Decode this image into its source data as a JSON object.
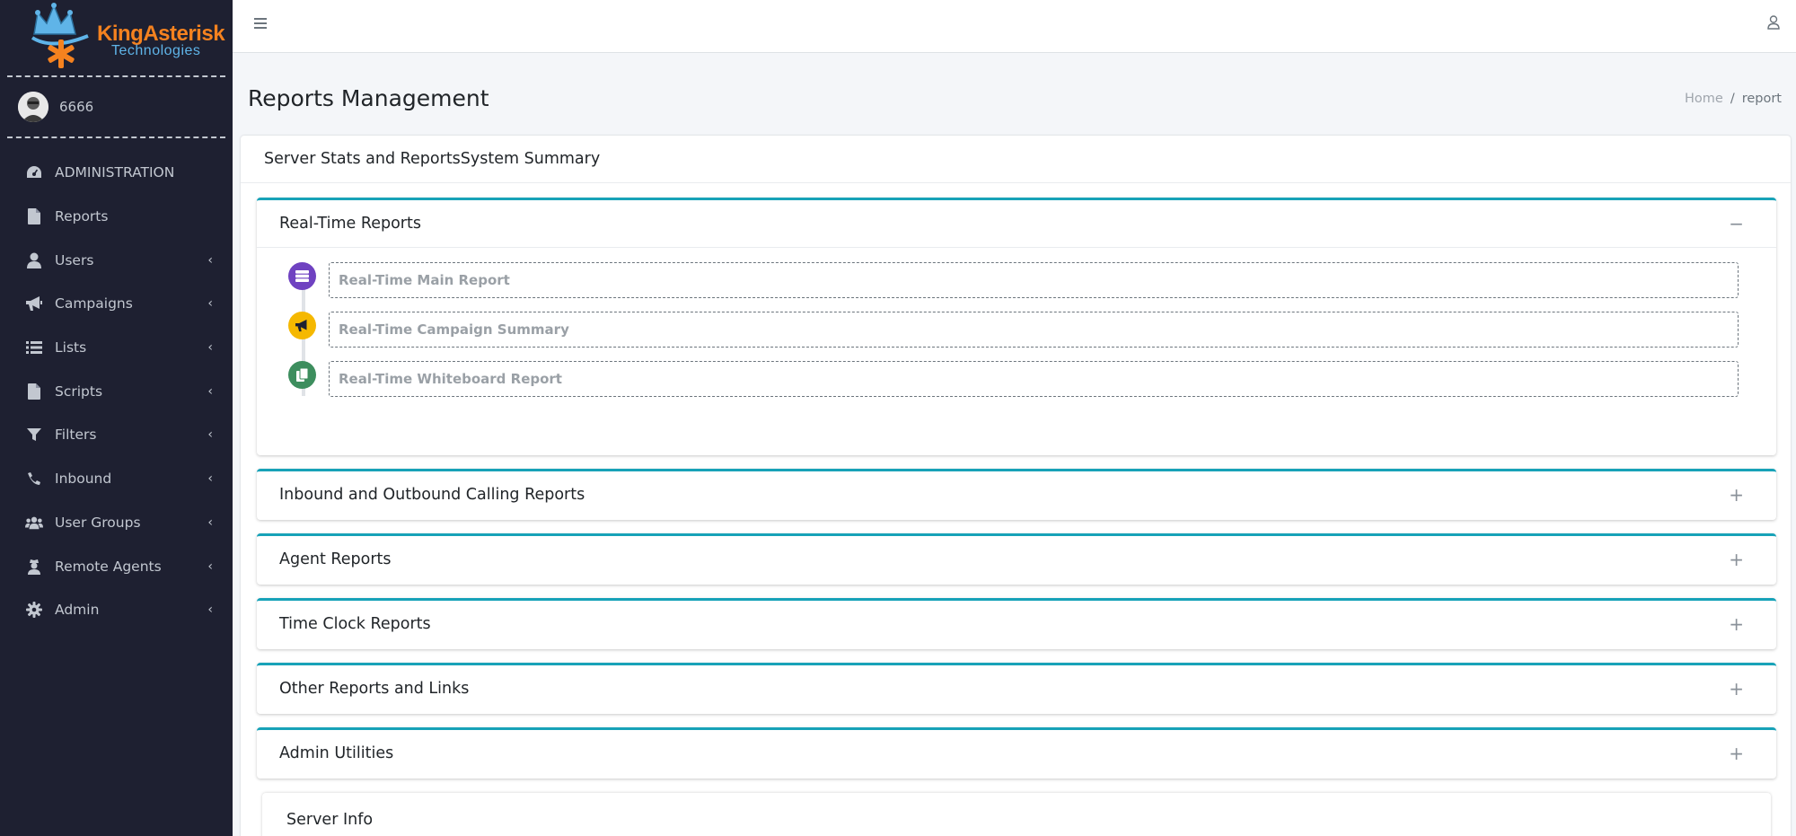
{
  "brand": {
    "line1": "KingAsterisk",
    "line2": "Technologies"
  },
  "user": {
    "name": "6666"
  },
  "sidebar": {
    "items": [
      {
        "label": "ADMINISTRATION",
        "icon": "tachometer-icon",
        "has_children": false
      },
      {
        "label": "Reports",
        "icon": "file-icon",
        "has_children": false
      },
      {
        "label": "Users",
        "icon": "user-icon",
        "has_children": true
      },
      {
        "label": "Campaigns",
        "icon": "bullhorn-icon",
        "has_children": true
      },
      {
        "label": "Lists",
        "icon": "list-icon",
        "has_children": true
      },
      {
        "label": "Scripts",
        "icon": "file-icon",
        "has_children": true
      },
      {
        "label": "Filters",
        "icon": "filter-icon",
        "has_children": true
      },
      {
        "label": "Inbound",
        "icon": "phone-icon",
        "has_children": true
      },
      {
        "label": "User Groups",
        "icon": "users-icon",
        "has_children": true
      },
      {
        "label": "Remote Agents",
        "icon": "user-secret-icon",
        "has_children": true
      },
      {
        "label": "Admin",
        "icon": "gear-icon",
        "has_children": true
      }
    ]
  },
  "header": {
    "title": "Reports Management",
    "breadcrumb": {
      "home": "Home",
      "sep": "/",
      "current": "report"
    }
  },
  "main": {
    "card_title": "Server Stats and ReportsSystem Summary",
    "sections": [
      {
        "label": "Real-Time Reports",
        "expanded": true,
        "toggle": "−",
        "items": [
          {
            "label": "Real-Time Main Report",
            "icon": "server-icon",
            "color": "#6f42c1"
          },
          {
            "label": "Real-Time Campaign Summary",
            "icon": "bullhorn-icon",
            "color": "#f5b800"
          },
          {
            "label": "Real-Time Whiteboard Report",
            "icon": "copy-icon",
            "color": "#3d8e5e"
          }
        ]
      },
      {
        "label": "Inbound and Outbound Calling Reports",
        "expanded": false,
        "toggle": "+"
      },
      {
        "label": "Agent Reports",
        "expanded": false,
        "toggle": "+"
      },
      {
        "label": "Time Clock Reports",
        "expanded": false,
        "toggle": "+"
      },
      {
        "label": "Other Reports and Links",
        "expanded": false,
        "toggle": "+"
      },
      {
        "label": "Admin Utilities",
        "expanded": false,
        "toggle": "+"
      }
    ],
    "server_info_title": "Server Info"
  },
  "colors": {
    "sidebar_bg": "#1e2031",
    "accent_border": "#17a2b8",
    "brand_orange": "#f5821f",
    "brand_blue": "#5fb4e8"
  }
}
